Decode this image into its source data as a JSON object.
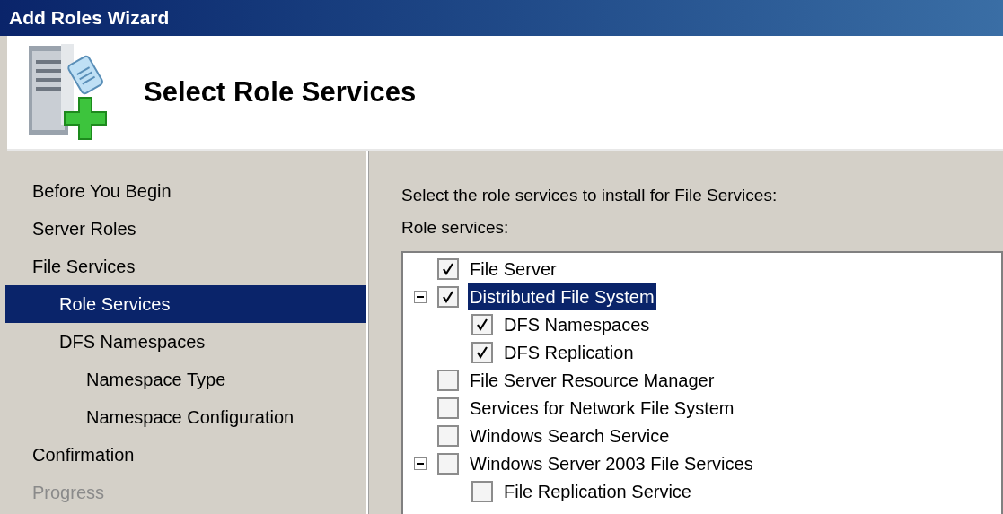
{
  "window": {
    "title": "Add Roles Wizard"
  },
  "header": {
    "title": "Select Role Services"
  },
  "steps": [
    {
      "label": "Before You Begin",
      "selected": false,
      "disabled": false
    },
    {
      "label": "Server Roles",
      "selected": false,
      "disabled": false
    },
    {
      "label": "File Services",
      "selected": false,
      "disabled": false,
      "children": [
        {
          "label": "Role Services",
          "selected": true,
          "disabled": false
        },
        {
          "label": "DFS Namespaces",
          "selected": false,
          "disabled": false,
          "children": [
            {
              "label": "Namespace Type",
              "selected": false,
              "disabled": false
            },
            {
              "label": "Namespace Configuration",
              "selected": false,
              "disabled": false
            }
          ]
        }
      ]
    },
    {
      "label": "Confirmation",
      "selected": false,
      "disabled": false
    },
    {
      "label": "Progress",
      "selected": false,
      "disabled": true
    }
  ],
  "content": {
    "instruction": "Select the role services to install for File Services:",
    "list_label": "Role services:",
    "role_services": [
      {
        "label": "File Server",
        "checked": true,
        "selected": false
      },
      {
        "label": "Distributed File System",
        "checked": true,
        "selected": true,
        "expanded": true,
        "children": [
          {
            "label": "DFS Namespaces",
            "checked": true,
            "selected": false
          },
          {
            "label": "DFS Replication",
            "checked": true,
            "selected": false
          }
        ]
      },
      {
        "label": "File Server Resource Manager",
        "checked": false,
        "selected": false
      },
      {
        "label": "Services for Network File System",
        "checked": false,
        "selected": false
      },
      {
        "label": "Windows Search Service",
        "checked": false,
        "selected": false
      },
      {
        "label": "Windows Server 2003 File Services",
        "checked": false,
        "selected": false,
        "expanded": true,
        "children": [
          {
            "label": "File Replication Service",
            "checked": false,
            "selected": false
          }
        ]
      }
    ]
  }
}
